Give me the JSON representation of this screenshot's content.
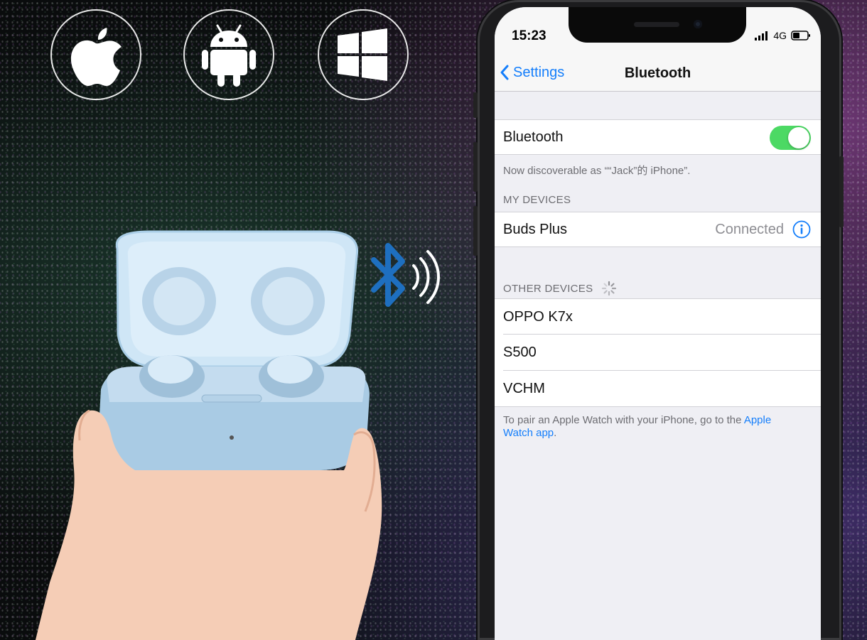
{
  "colors": {
    "accent": "#147efb",
    "toggle_on": "#4cd964",
    "bluetooth_symbol": "#1e6fbf"
  },
  "os_badges": [
    "apple-icon",
    "android-icon",
    "windows-icon"
  ],
  "status_bar": {
    "time": "15:23",
    "network": "4G"
  },
  "nav": {
    "back_label": "Settings",
    "title": "Bluetooth"
  },
  "bluetooth_row": {
    "label": "Bluetooth",
    "toggle_on": true
  },
  "discoverable_text": "Now discoverable as ““Jack”的 iPhone”.",
  "my_devices": {
    "header": "MY DEVICES",
    "items": [
      {
        "name": "Buds Plus",
        "status": "Connected"
      }
    ]
  },
  "other_devices": {
    "header": "OTHER DEVICES",
    "items": [
      {
        "name": "OPPO K7x"
      },
      {
        "name": "S500"
      },
      {
        "name": "VCHM"
      }
    ]
  },
  "footer": {
    "text": "To pair an Apple Watch with your iPhone, go to the ",
    "link_part1": "Apple",
    "link_part2": "Watch app",
    "end": "."
  }
}
